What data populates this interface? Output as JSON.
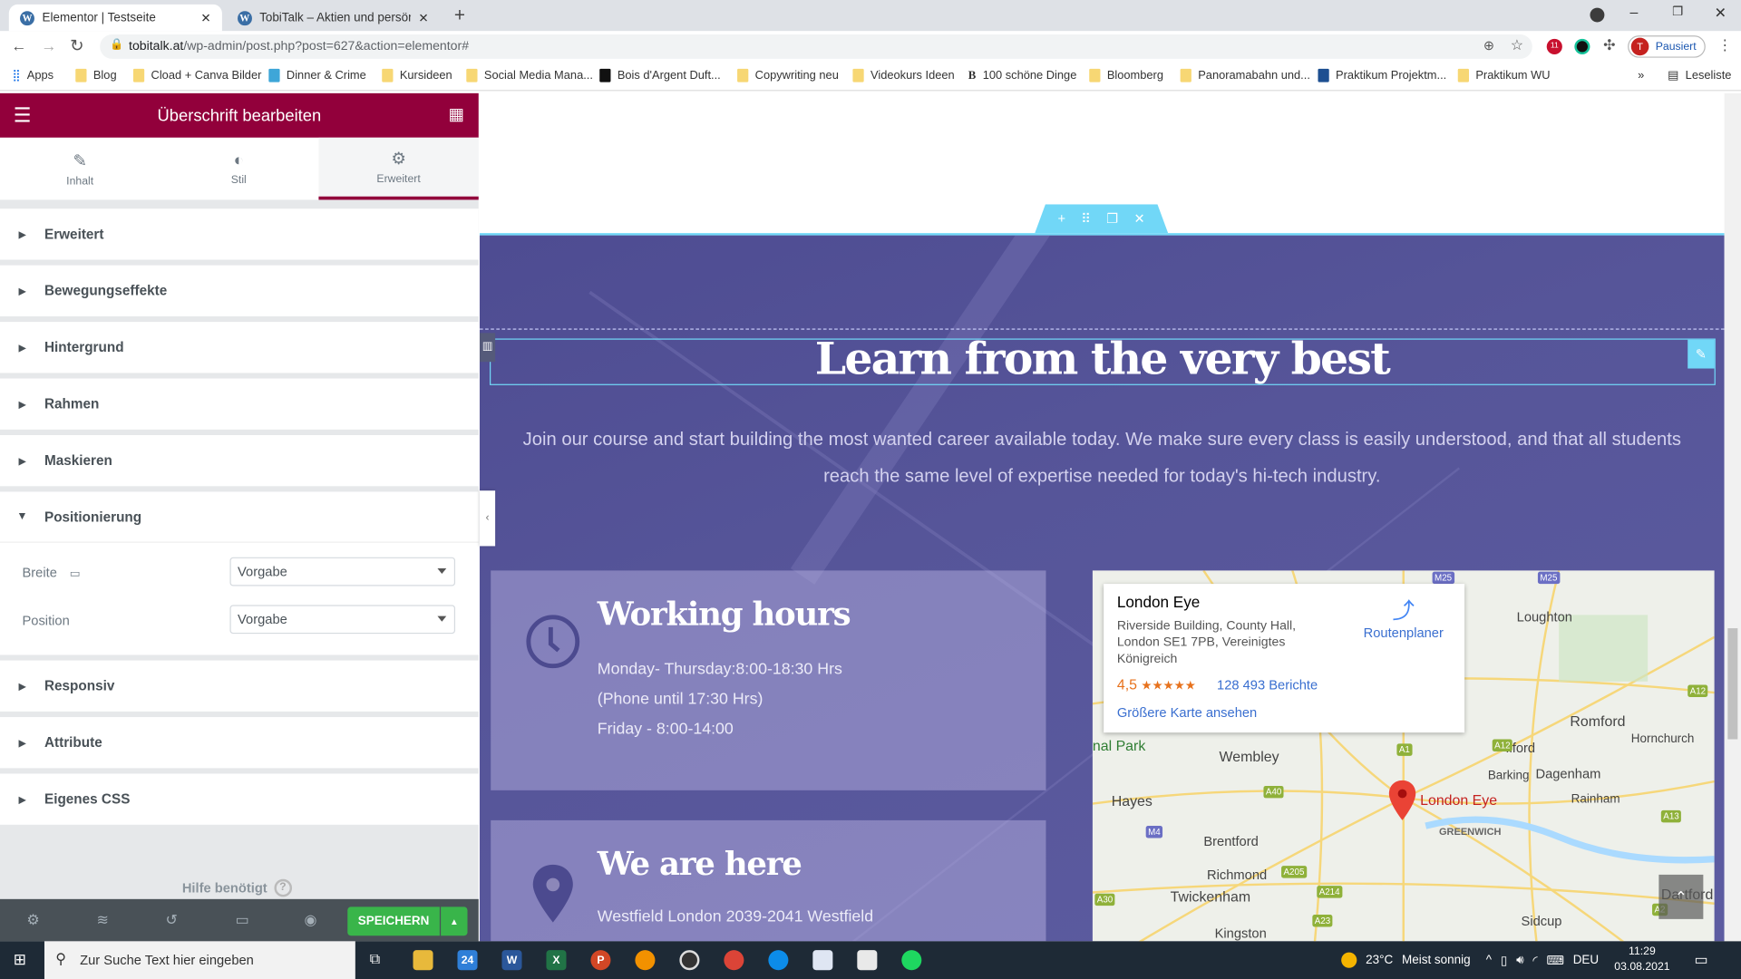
{
  "browser": {
    "tabs": [
      {
        "title": "Elementor | Testseite",
        "active": true
      },
      {
        "title": "TobiTalk – Aktien und persönliche",
        "active": false
      }
    ],
    "new_tab": "+",
    "url_host": "tobitalk.at",
    "url_path": "/wp-admin/post.php?post=627&action=elementor#",
    "profile_initial": "T",
    "profile_status": "Pausiert",
    "ext_badge": "11",
    "bookmarks": [
      "Apps",
      "Blog",
      "Cload + Canva Bilder",
      "Dinner & Crime",
      "Kursideen",
      "Social Media Mana...",
      "Bois d'Argent Duft...",
      "Copywriting neu",
      "Videokurs Ideen",
      "100 schöne Dinge",
      "Bloomberg",
      "Panoramabahn und...",
      "Praktikum Projektm...",
      "Praktikum WU"
    ],
    "more": "»",
    "reading_list": "Leseliste"
  },
  "panel": {
    "title": "Überschrift bearbeiten",
    "tabs": [
      {
        "label": "Inhalt",
        "icon": "pencil-icon"
      },
      {
        "label": "Stil",
        "icon": "contrast-icon"
      },
      {
        "label": "Erweitert",
        "icon": "gear-icon",
        "active": true
      }
    ],
    "sections": [
      "Erweitert",
      "Bewegungseffekte",
      "Hintergrund",
      "Rahmen",
      "Maskieren",
      "Positionierung",
      "Responsiv",
      "Attribute",
      "Eigenes CSS"
    ],
    "expanded": "Positionierung",
    "fields": [
      {
        "label": "Breite",
        "value": "Vorgabe"
      },
      {
        "label": "Position",
        "value": "Vorgabe"
      }
    ],
    "help": "Hilfe benötigt",
    "save": "SPEICHERN",
    "accent": "#92003b"
  },
  "page": {
    "heading": "Learn from the very best",
    "paragraph": "Join our course and start building the most wanted career available today. We make sure every class is easily understood, and that all students reach the same level of expertise needed for today's hi-tech industry.",
    "cards": [
      {
        "title": "Working hours",
        "icon": "clock-icon",
        "lines": [
          "Monday- Thursday:8:00-18:30 Hrs",
          "(Phone until 17:30 Hrs)",
          "Friday - 8:00-14:00"
        ]
      },
      {
        "title": "We are here",
        "icon": "map-pin-icon",
        "lines": [
          "Westfield London 2039-2041 Westfield"
        ]
      }
    ],
    "map": {
      "place": "London Eye",
      "address": [
        "Riverside Building, County Hall,",
        "London SE1 7PB, Vereinigtes",
        "Königreich"
      ],
      "rating": "4,5",
      "stars": "★★★★★",
      "reviews": "128 493 Berichte",
      "larger": "Größere Karte ansehen",
      "directions": "Routenplaner",
      "labels": [
        "Loughton",
        "Romford",
        "Hornchurch",
        "Ilford",
        "Barking",
        "Dagenham",
        "Rainham",
        "Wembley",
        "Hayes",
        "Brentford",
        "Richmond",
        "Twickenham",
        "Kingston",
        "Sidcup",
        "Dartford",
        "GREENWICH",
        "nal Park",
        "wn"
      ],
      "roads": [
        "M25",
        "M25",
        "A12",
        "A1",
        "A12",
        "A40",
        "A13",
        "M4",
        "A205",
        "A214",
        "A23",
        "A30",
        "A2"
      ],
      "marker_label": "London Eye"
    }
  },
  "taskbar": {
    "search": "Zur Suche Text hier eingeben",
    "mail_badge": "24",
    "weather": "23°C",
    "weather_desc": "Meist sonnig",
    "lang": "DEU",
    "time": "11:29",
    "date": "03.08.2021"
  }
}
